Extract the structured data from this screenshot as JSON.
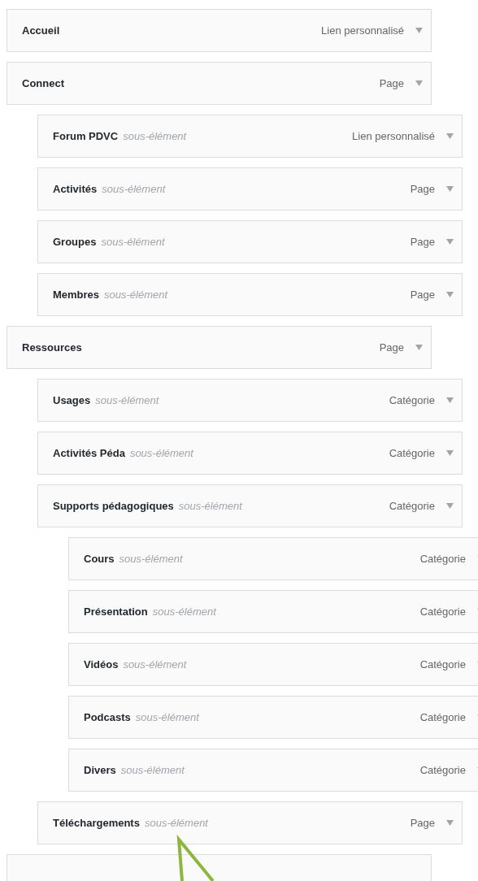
{
  "menu_items": [
    {
      "kind": "item",
      "title": "Accueil",
      "type": "Lien personnalisé"
    },
    {
      "kind": "item",
      "title": "Connect",
      "type": "Page",
      "children": [
        {
          "kind": "item",
          "title": "Forum PDVC",
          "subtitle": "sous-élément",
          "type": "Lien personnalisé"
        },
        {
          "kind": "item",
          "title": "Activités",
          "subtitle": "sous-élément",
          "type": "Page"
        },
        {
          "kind": "item",
          "title": "Groupes",
          "subtitle": "sous-élément",
          "type": "Page"
        },
        {
          "kind": "item",
          "title": "Membres",
          "subtitle": "sous-élément",
          "type": "Page"
        }
      ]
    },
    {
      "kind": "item",
      "title": "Ressources",
      "type": "Page",
      "children": [
        {
          "kind": "item",
          "title": "Usages",
          "subtitle": "sous-élément",
          "type": "Catégorie"
        },
        {
          "kind": "item",
          "title": "Activités Péda",
          "subtitle": "sous-élément",
          "type": "Catégorie"
        },
        {
          "kind": "item",
          "title": "Supports pédagogiques",
          "subtitle": "sous-élément",
          "type": "Catégorie",
          "children": [
            {
              "kind": "item",
              "title": "Cours",
              "subtitle": "sous-élément",
              "type": "Catégorie"
            },
            {
              "kind": "item",
              "title": "Présentation",
              "subtitle": "sous-élément",
              "type": "Catégorie"
            },
            {
              "kind": "item",
              "title": "Vidéos",
              "subtitle": "sous-élément",
              "type": "Catégorie"
            },
            {
              "kind": "item",
              "title": "Podcasts",
              "subtitle": "sous-élément",
              "type": "Catégorie"
            },
            {
              "kind": "item",
              "title": "Divers",
              "subtitle": "sous-élément",
              "type": "Catégorie"
            }
          ]
        },
        {
          "kind": "item",
          "title": "Téléchargements",
          "subtitle": "sous-élément",
          "type": "Page"
        }
      ]
    },
    {
      "kind": "stub"
    }
  ],
  "annotation": {
    "kind": "arrow"
  }
}
